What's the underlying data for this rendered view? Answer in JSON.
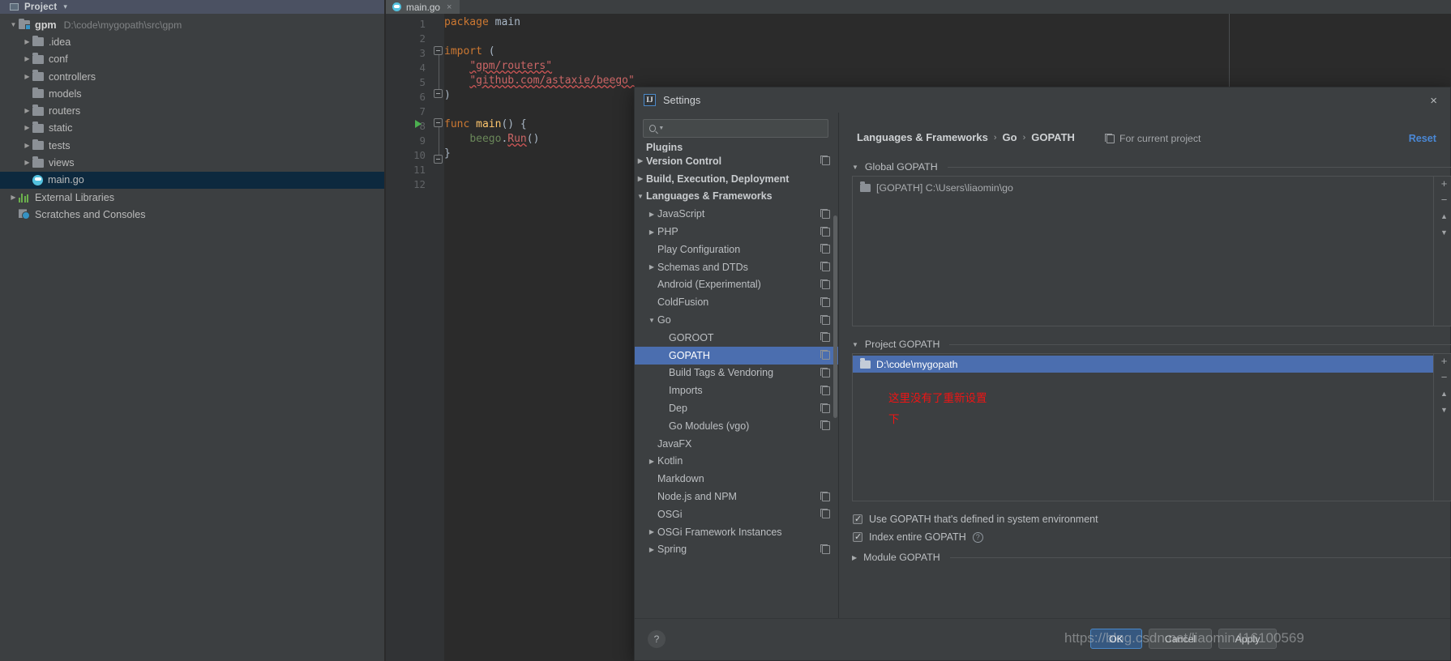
{
  "ide": {
    "project_panel": {
      "title": "Project",
      "caret": "▾",
      "icon": "project-panel-icon"
    },
    "toolbar_icons": [
      "help-icon",
      "collapse-all-icon",
      "settings-gear-icon",
      "minimize-icon"
    ],
    "tree": [
      {
        "label": "gpm",
        "path": "D:\\code\\mygopath\\src\\gpm",
        "type": "source-folder",
        "expanded": true,
        "depth": 0
      },
      {
        "label": ".idea",
        "type": "folder",
        "expanded": false,
        "depth": 1
      },
      {
        "label": "conf",
        "type": "folder",
        "expanded": false,
        "depth": 1
      },
      {
        "label": "controllers",
        "type": "folder",
        "expanded": false,
        "depth": 1
      },
      {
        "label": "models",
        "type": "folder",
        "expanded": null,
        "depth": 1
      },
      {
        "label": "routers",
        "type": "folder",
        "expanded": false,
        "depth": 1
      },
      {
        "label": "static",
        "type": "folder",
        "expanded": false,
        "depth": 1
      },
      {
        "label": "tests",
        "type": "folder",
        "expanded": false,
        "depth": 1
      },
      {
        "label": "views",
        "type": "folder",
        "expanded": false,
        "depth": 1
      },
      {
        "label": "main.go",
        "type": "go-file",
        "selected": true,
        "depth": 1
      },
      {
        "label": "External Libraries",
        "type": "libraries",
        "expanded": false,
        "depth": 0
      },
      {
        "label": "Scratches and Consoles",
        "type": "scratches",
        "depth": 0
      }
    ],
    "editor": {
      "tab": {
        "label": "main.go",
        "close": "×"
      },
      "line_numbers": [
        "1",
        "2",
        "3",
        "4",
        "5",
        "6",
        "7",
        "8",
        "9",
        "10",
        "11",
        "12"
      ],
      "code_lines": [
        "package main",
        "",
        "import (",
        "    \"gpm/routers\"",
        "    \"github.com/astaxie/beego\"",
        ")",
        "",
        "func main() {",
        "    beego.Run()",
        "}",
        "",
        ""
      ]
    }
  },
  "dialog": {
    "title": "Settings",
    "close_label": "×",
    "search": {
      "placeholder": "",
      "value": "",
      "icon": "search-icon"
    },
    "nav": [
      {
        "label": "Plugins",
        "bold": true,
        "tri": "",
        "copy": false,
        "partial": true
      },
      {
        "label": "Version Control",
        "bold": true,
        "tri": "▶",
        "copy": true
      },
      {
        "label": "Build, Execution, Deployment",
        "bold": true,
        "tri": "▶",
        "copy": false
      },
      {
        "label": "Languages & Frameworks",
        "bold": true,
        "tri": "▼",
        "copy": false
      },
      {
        "label": "JavaScript",
        "bold": false,
        "tri": "▶",
        "copy": true,
        "indent": 1
      },
      {
        "label": "PHP",
        "bold": false,
        "tri": "▶",
        "copy": true,
        "indent": 1
      },
      {
        "label": "Play Configuration",
        "bold": false,
        "tri": "",
        "copy": true,
        "indent": 1
      },
      {
        "label": "Schemas and DTDs",
        "bold": false,
        "tri": "▶",
        "copy": true,
        "indent": 1
      },
      {
        "label": "Android (Experimental)",
        "bold": false,
        "tri": "",
        "copy": true,
        "indent": 1
      },
      {
        "label": "ColdFusion",
        "bold": false,
        "tri": "",
        "copy": true,
        "indent": 1
      },
      {
        "label": "Go",
        "bold": false,
        "tri": "▼",
        "copy": true,
        "indent": 1
      },
      {
        "label": "GOROOT",
        "bold": false,
        "tri": "",
        "copy": true,
        "indent": 2
      },
      {
        "label": "GOPATH",
        "bold": false,
        "tri": "",
        "copy": true,
        "indent": 2,
        "selected": true
      },
      {
        "label": "Build Tags & Vendoring",
        "bold": false,
        "tri": "",
        "copy": true,
        "indent": 2
      },
      {
        "label": "Imports",
        "bold": false,
        "tri": "",
        "copy": true,
        "indent": 2
      },
      {
        "label": "Dep",
        "bold": false,
        "tri": "",
        "copy": true,
        "indent": 2
      },
      {
        "label": "Go Modules (vgo)",
        "bold": false,
        "tri": "",
        "copy": true,
        "indent": 2
      },
      {
        "label": "JavaFX",
        "bold": false,
        "tri": "",
        "copy": false,
        "indent": 1
      },
      {
        "label": "Kotlin",
        "bold": false,
        "tri": "▶",
        "copy": false,
        "indent": 1
      },
      {
        "label": "Markdown",
        "bold": false,
        "tri": "",
        "copy": false,
        "indent": 1
      },
      {
        "label": "Node.js and NPM",
        "bold": false,
        "tri": "",
        "copy": true,
        "indent": 1
      },
      {
        "label": "OSGi",
        "bold": false,
        "tri": "",
        "copy": true,
        "indent": 1
      },
      {
        "label": "OSGi Framework Instances",
        "bold": false,
        "tri": "▶",
        "copy": false,
        "indent": 1
      },
      {
        "label": "Spring",
        "bold": false,
        "tri": "▶",
        "copy": true,
        "indent": 1
      }
    ],
    "breadcrumb": [
      "Languages & Frameworks",
      "Go",
      "GOPATH"
    ],
    "breadcrumb_sep": "›",
    "for_current_project": "For current project",
    "reset_label": "Reset",
    "global_gopath": {
      "section_title": "Global GOPATH",
      "tri": "▼",
      "entries": [
        "[GOPATH] C:\\Users\\liaomin\\go"
      ],
      "buttons": [
        "+",
        "−",
        "▲",
        "▼"
      ]
    },
    "project_gopath": {
      "section_title": "Project GOPATH",
      "tri": "▼",
      "entries": [
        "D:\\code\\mygopath"
      ],
      "selected_index": 0,
      "buttons": [
        "+",
        "−",
        "▲",
        "▼"
      ]
    },
    "annotation": "这里没有了重新设置\n下",
    "annotation_color": "#f01414",
    "checkboxes": [
      {
        "label": "Use GOPATH that's defined in system environment",
        "checked": true,
        "help": false
      },
      {
        "label": "Index entire GOPATH",
        "checked": true,
        "help": true
      }
    ],
    "module_gopath": {
      "section_title": "Module GOPATH",
      "tri": "▶"
    },
    "footer": {
      "help": "?",
      "buttons": [
        {
          "label": "OK",
          "primary": true
        },
        {
          "label": "Cancel",
          "primary": false
        },
        {
          "label": "Apply",
          "primary": false
        }
      ]
    }
  },
  "watermark": "https://blog.csdn.net/liaomin416100569",
  "colors": {
    "accent": "#4b6eaf",
    "link": "#4a88d6",
    "panel": "#3c3f41",
    "editor_bg": "#2b2b2b",
    "selection": "#0d293e",
    "annotation": "#f01414"
  }
}
